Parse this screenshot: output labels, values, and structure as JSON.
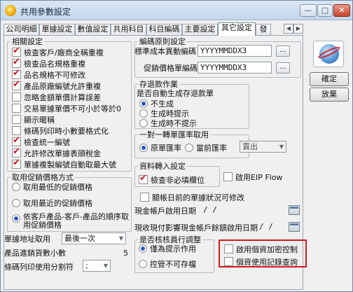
{
  "window": {
    "title": "共用參數設定",
    "buttons": {
      "minimize": "—",
      "maximize": "□",
      "close": "✕"
    }
  },
  "tabs": [
    {
      "label": "公司明細",
      "active": false
    },
    {
      "label": "單據設定",
      "active": false
    },
    {
      "label": "數值設定",
      "active": false
    },
    {
      "label": "共用科目",
      "active": false
    },
    {
      "label": "科目編碼",
      "active": false
    },
    {
      "label": "主要設定",
      "active": false
    },
    {
      "label": "其它設定",
      "active": true
    },
    {
      "label": "發",
      "active": false
    }
  ],
  "related": {
    "legend": "相關設定",
    "items": [
      {
        "label": "檢查客戶/廠商全稱重複",
        "checked": true
      },
      {
        "label": "檢查品名規格重複",
        "checked": true
      },
      {
        "label": "品名規格不可修改",
        "checked": true
      },
      {
        "label": "產品原廠編號允許重複",
        "checked": true
      },
      {
        "label": "忽略金額單價計算誤差",
        "checked": false
      },
      {
        "label": "交易單據單價不可小於等於0",
        "checked": false
      },
      {
        "label": "顯示暱稱",
        "checked": false
      },
      {
        "label": "條碼列印時小數要格式化",
        "checked": false
      },
      {
        "label": "檢查統一編號",
        "checked": true
      },
      {
        "label": "允許修改單據表頭稅金",
        "checked": true
      },
      {
        "label": "單據複製編號自動取最大號",
        "checked": true
      }
    ]
  },
  "promo": {
    "legend": "取用促銷價格方式",
    "options": [
      {
        "label": "取用最低的促銷價格",
        "selected": false
      },
      {
        "label": "取用最近的促銷價格",
        "selected": false
      },
      {
        "label": "依客戶產品-客戶-產品的順序取用促銷價格",
        "selected": true
      }
    ],
    "address_label": "單據地址取用",
    "address_value": "最後一次",
    "decimal_label": "產品進銷貨數小數",
    "decimal_value": "5",
    "delimiter_label": "條碼列印使用分割符",
    "delimiter_value": ";"
  },
  "encoding": {
    "legend": "編碼原則設定",
    "cost_label": "標準成本異動編碼",
    "cost_value": "YYYYMMDDX3",
    "promo_label": "促銷價格單編碼",
    "promo_value": "YYYYMMDDX3",
    "button": "..."
  },
  "inventory": {
    "legend": "存退款作業",
    "question": "是否自動生成存退款單",
    "options": [
      {
        "label": "不生成",
        "selected": true
      },
      {
        "label": "生成時提示",
        "selected": false
      },
      {
        "label": "生成時不提示",
        "selected": false
      }
    ]
  },
  "exchange": {
    "legend": "一對一轉單匯率取用",
    "options": [
      {
        "label": "原單匯率",
        "selected": true
      },
      {
        "label": "當前匯率",
        "selected": false
      }
    ],
    "select_value": "賣出"
  },
  "import": {
    "legend": "資料轉入設定",
    "check_label": "檢查非必填欄位",
    "check_checked": true,
    "eip_label": "啟用EIP Flow",
    "eip_checked": false
  },
  "close_account": {
    "label": "關帳日前的單據狀況可修改",
    "checked": false
  },
  "dates": {
    "ar_label": "現金帳戶啟用日期",
    "ar_value": "/ /",
    "payment_label": "現收現付影響現金帳戶餘額啟用日期",
    "payment_value": "/ /"
  },
  "approval": {
    "legend": "是否核核員行調整",
    "options": [
      {
        "label": "僅為提示作用",
        "selected": true
      },
      {
        "label": "控管不可存檔",
        "selected": false
      }
    ]
  },
  "options_right": [
    {
      "label": "啟用個資加密控制",
      "checked": false
    },
    {
      "label": "個資使用記錄查詢",
      "checked": false
    }
  ],
  "side": {
    "icon": "globe-icon",
    "ok": "確定",
    "cancel": "放棄"
  },
  "colors": {
    "checkmark": "#c4152a",
    "highlight": "#c81e1e"
  }
}
